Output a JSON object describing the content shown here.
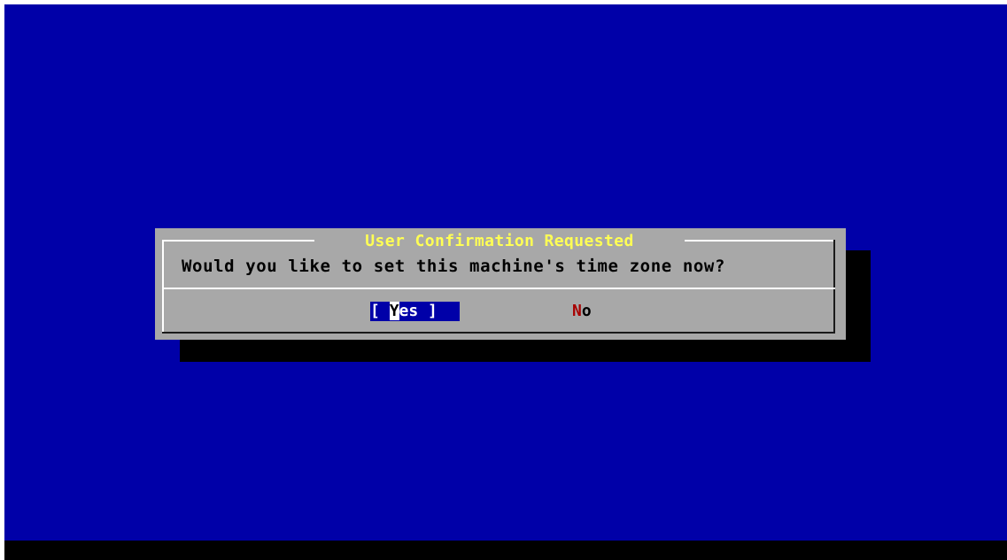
{
  "dialog": {
    "title": "User Confirmation Requested",
    "message": "Would you like to set this machine's time zone now?",
    "buttons": {
      "yes": {
        "open_bracket": "[ ",
        "hotkey": "Y",
        "rest": "es",
        "close_bracket": " ]",
        "selected": true
      },
      "no": {
        "hotkey": "N",
        "rest": "o",
        "selected": false
      }
    }
  },
  "colors": {
    "desktop_background": "#0000a8",
    "dialog_background": "#a8a8a8",
    "title_color": "#ffff54",
    "hotkey_color": "#a80000",
    "selected_button_background": "#0000a8",
    "shadow": "#000000"
  }
}
